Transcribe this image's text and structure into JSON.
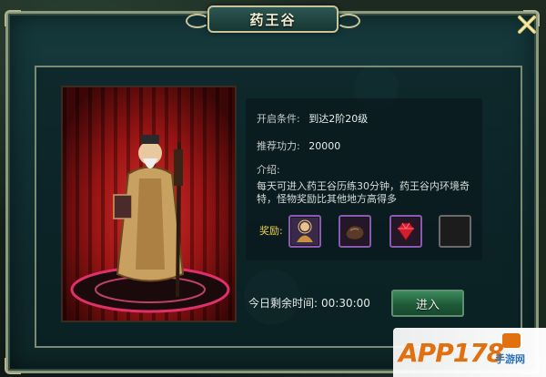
{
  "window": {
    "title": "药王谷"
  },
  "info": {
    "condition_label": "开启条件:",
    "condition_value": "到达2阶20级",
    "power_label": "推荐功力:",
    "power_value": "20000",
    "intro_label": "介绍:",
    "intro_text": "每天可进入药王谷历练30分钟，药王谷内环境奇特，怪物奖励比其他地方高得多"
  },
  "rewards": {
    "label": "奖励:",
    "items": [
      {
        "icon": "buddha-figure-icon",
        "rarity_color": "#8a5ab0"
      },
      {
        "icon": "ore-stone-icon",
        "rarity_color": "#8a5ab0"
      },
      {
        "icon": "red-gem-icon",
        "rarity_color": "#8a5ab0"
      },
      {
        "icon": "empty-slot",
        "rarity_color": "#6a6a6a"
      }
    ]
  },
  "timer": {
    "label": "今日剩余时间:",
    "value": "00:30:00"
  },
  "actions": {
    "enter_label": "进入"
  },
  "watermark": {
    "text": "APP178",
    "sub": "手游网"
  },
  "colors": {
    "frame": "#163a3c",
    "accent_gold": "#c9c59a",
    "reward_label": "#f0d040",
    "button_green": "#3c8a5c"
  }
}
